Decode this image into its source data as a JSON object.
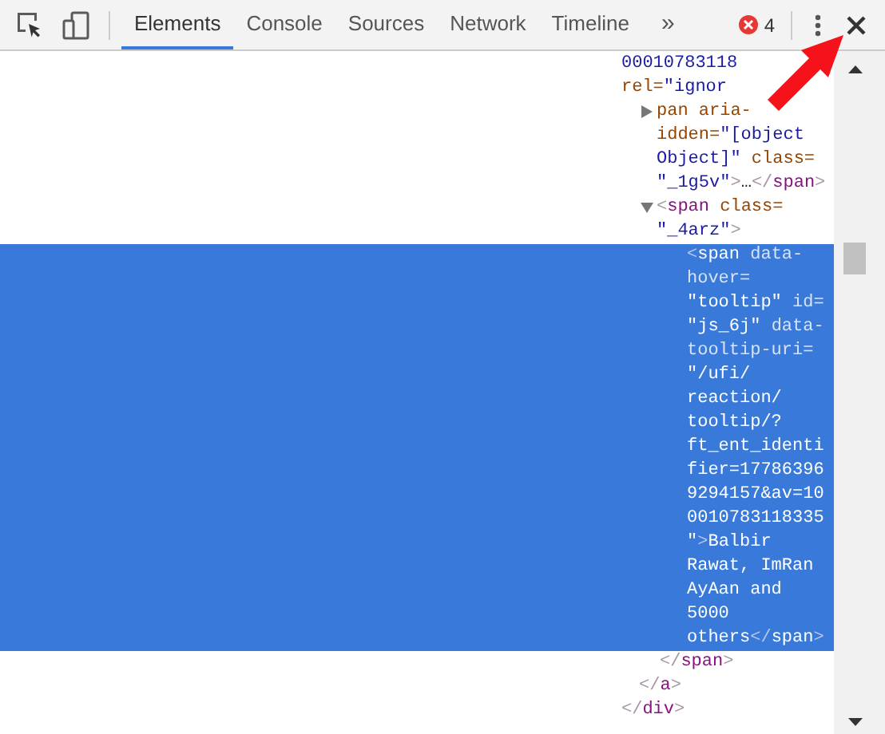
{
  "toolbar": {
    "tabs": [
      {
        "label": "Elements",
        "selected": true
      },
      {
        "label": "Console",
        "selected": false
      },
      {
        "label": "Sources",
        "selected": false
      },
      {
        "label": "Network",
        "selected": false
      },
      {
        "label": "Timeline",
        "selected": false
      }
    ],
    "more": "»",
    "error_count": "4"
  },
  "tree": [
    {
      "close": [
        {
          "kind": "punct",
          "text": "</"
        },
        {
          "kind": "tag",
          "text": "div"
        },
        {
          "kind": "punct",
          "text": ">"
        }
      ],
      "children": [
        {
          "selected": false,
          "lines": [
            [
              {
                "kind": "value",
                "text": "00010783118"
              }
            ],
            [
              {
                "kind": "attr",
                "text": "rel="
              },
              {
                "kind": "value",
                "text": "\"ignor"
              }
            ]
          ],
          "close": [
            {
              "kind": "punct",
              "text": "</"
            },
            {
              "kind": "tag",
              "text": "a"
            },
            {
              "kind": "punct",
              "text": ">"
            }
          ],
          "children": [
            {
              "selected": false,
              "expanded": false,
              "lines": [
                [
                  {
                    "kind": "attr",
                    "text": "pan aria-"
                  }
                ],
                [
                  {
                    "kind": "attr",
                    "text": "idden="
                  },
                  {
                    "kind": "value",
                    "text": "\"[object"
                  }
                ],
                [
                  {
                    "kind": "value",
                    "text": "Object]\""
                  },
                  {
                    "kind": "attr",
                    "text": " class="
                  }
                ],
                [
                  {
                    "kind": "value",
                    "text": "\"_1g5v\""
                  },
                  {
                    "kind": "punct",
                    "text": ">"
                  },
                  {
                    "kind": "text",
                    "text": "…"
                  },
                  {
                    "kind": "punct",
                    "text": "</"
                  },
                  {
                    "kind": "tag",
                    "text": "span"
                  },
                  {
                    "kind": "punct",
                    "text": ">"
                  }
                ]
              ]
            },
            {
              "selected": false,
              "expanded": true,
              "lines": [
                [
                  {
                    "kind": "punct",
                    "text": "<"
                  },
                  {
                    "kind": "tag",
                    "text": "span"
                  },
                  {
                    "kind": "attr",
                    "text": " class="
                  }
                ],
                [
                  {
                    "kind": "value",
                    "text": "\"_4arz\""
                  },
                  {
                    "kind": "punct",
                    "text": ">"
                  }
                ]
              ],
              "close": [
                {
                  "kind": "punct",
                  "text": "</"
                },
                {
                  "kind": "tag",
                  "text": "span"
                },
                {
                  "kind": "punct",
                  "text": ">"
                }
              ],
              "children": [
                {
                  "selected": true,
                  "lines": [
                    [
                      {
                        "kind": "punct",
                        "text": "<"
                      },
                      {
                        "kind": "tag",
                        "text": "span"
                      },
                      {
                        "kind": "attr",
                        "text": " data-"
                      }
                    ],
                    [
                      {
                        "kind": "attr",
                        "text": "hover="
                      }
                    ],
                    [
                      {
                        "kind": "value",
                        "text": "\"tooltip\""
                      },
                      {
                        "kind": "attr",
                        "text": " id="
                      }
                    ],
                    [
                      {
                        "kind": "value",
                        "text": "\"js_6j\""
                      },
                      {
                        "kind": "attr",
                        "text": " data-"
                      }
                    ],
                    [
                      {
                        "kind": "attr",
                        "text": "tooltip-uri="
                      }
                    ],
                    [
                      {
                        "kind": "value",
                        "text": "\"/ufi/"
                      }
                    ],
                    [
                      {
                        "kind": "value",
                        "text": "reaction/"
                      }
                    ],
                    [
                      {
                        "kind": "value",
                        "text": "tooltip/?"
                      }
                    ],
                    [
                      {
                        "kind": "value",
                        "text": "ft_ent_identi"
                      }
                    ],
                    [
                      {
                        "kind": "value",
                        "text": "fier=17786396"
                      }
                    ],
                    [
                      {
                        "kind": "value",
                        "text": "9294157&av=10"
                      }
                    ],
                    [
                      {
                        "kind": "value",
                        "text": "0010783118335"
                      }
                    ],
                    [
                      {
                        "kind": "value",
                        "text": "\""
                      },
                      {
                        "kind": "punct",
                        "text": ">"
                      },
                      {
                        "kind": "text",
                        "text": "Balbir"
                      }
                    ],
                    [
                      {
                        "kind": "text",
                        "text": "Rawat, ImRan"
                      }
                    ],
                    [
                      {
                        "kind": "text",
                        "text": "AyAan and"
                      }
                    ],
                    [
                      {
                        "kind": "text",
                        "text": "5000"
                      }
                    ],
                    [
                      {
                        "kind": "text",
                        "text": "others"
                      },
                      {
                        "kind": "punct",
                        "text": "</"
                      },
                      {
                        "kind": "tag",
                        "text": "span"
                      },
                      {
                        "kind": "punct",
                        "text": ">"
                      }
                    ]
                  ]
                }
              ]
            }
          ]
        }
      ]
    }
  ]
}
